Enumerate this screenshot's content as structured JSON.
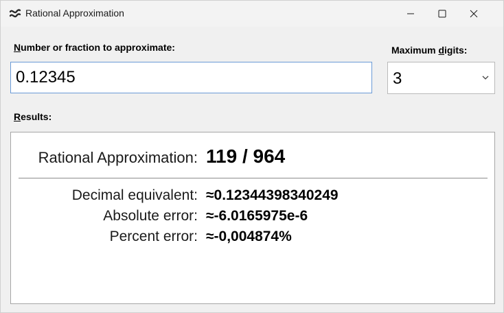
{
  "window": {
    "title": "Rational Approximation",
    "icon": "approx-equal-icon"
  },
  "input": {
    "label_underline": "N",
    "label_rest": "umber or fraction to approximate:",
    "value": "0.12345"
  },
  "digits": {
    "label_start": "Maximum ",
    "label_underline": "d",
    "label_rest": "igits:",
    "value": "3"
  },
  "results": {
    "label_underline": "R",
    "label_rest": "esults:",
    "approximation_label": "Rational Approximation:",
    "approximation_value": "119 / 964",
    "decimal_label": "Decimal equivalent:",
    "decimal_value": "≈0.12344398340249",
    "abs_error_label": "Absolute error:",
    "abs_error_value": "≈-6.0165975e-6",
    "pct_error_label": "Percent error:",
    "pct_error_value": "≈-0,004874%"
  },
  "colors": {
    "input_border": "#6a9ad6",
    "window_bg": "#f0f0f0"
  }
}
